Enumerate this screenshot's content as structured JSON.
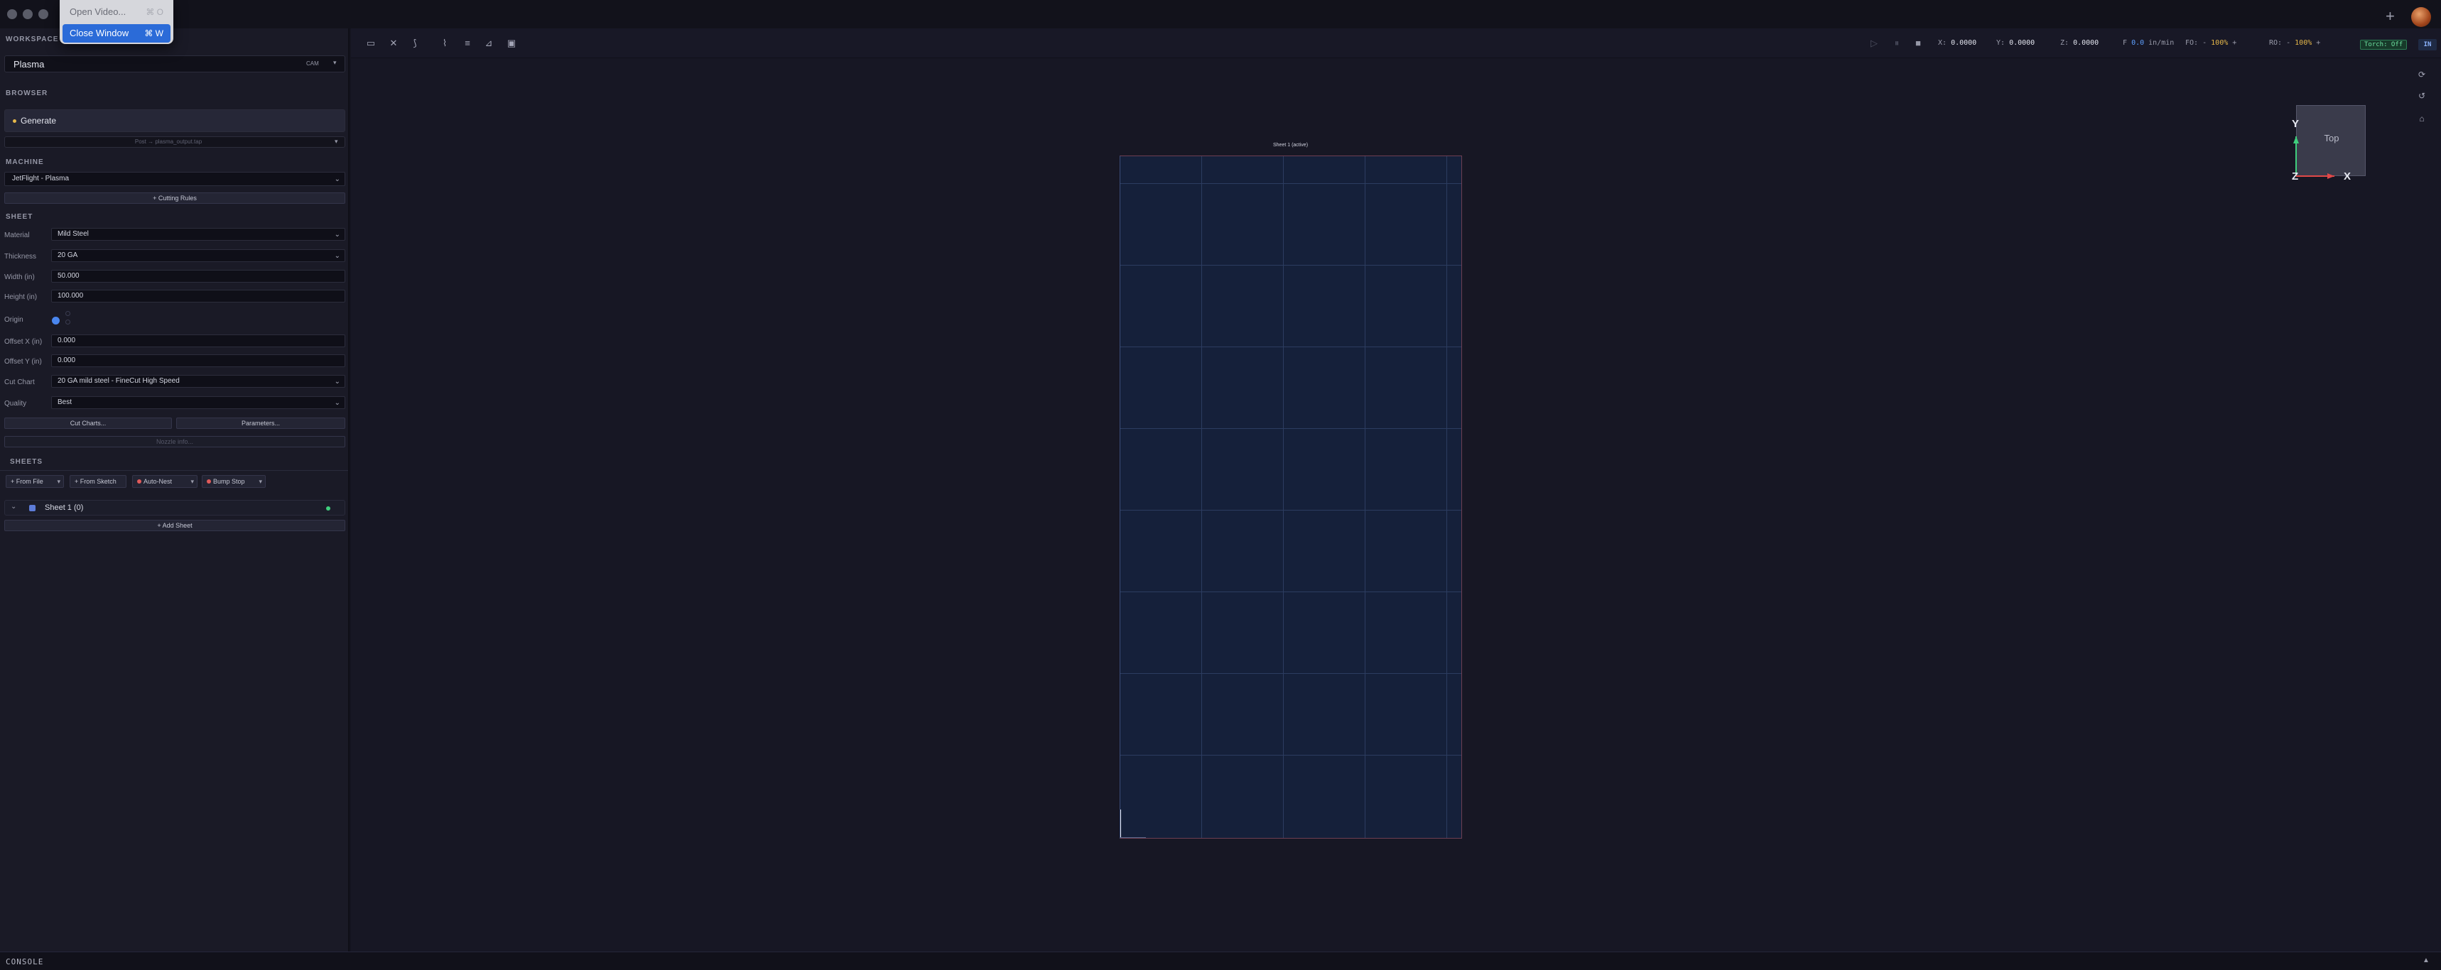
{
  "menu": {
    "open_video": "Open Video...",
    "open_video_shortcut": "⌘ O",
    "close_window": "Close Window",
    "close_window_shortcut": "⌘ W"
  },
  "sidebar": {
    "workspace_label": "WORKSPACE",
    "workspace_value": "Plasma",
    "workspace_tag": "CAM",
    "browser_label": "BROWSER",
    "generate_label": "Generate",
    "post_output": "Post → plasma_output.tap",
    "machine_label": "MACHINE",
    "machine_value": "JetFlight - Plasma",
    "cutting_rules": "+ Cutting Rules",
    "sheet_label": "SHEET",
    "fields": {
      "material": {
        "label": "Material",
        "value": "Mild Steel"
      },
      "thickness": {
        "label": "Thickness",
        "value": "20 GA"
      },
      "width": {
        "label": "Width (in)",
        "value": "50.000"
      },
      "height": {
        "label": "Height (in)",
        "value": "100.000"
      },
      "origin": {
        "label": "Origin"
      },
      "offset_x": {
        "label": "Offset X (in)",
        "value": "0.000"
      },
      "offset_y": {
        "label": "Offset Y (in)",
        "value": "0.000"
      },
      "cut_chart": {
        "label": "Cut Chart",
        "value": "20 GA mild steel - FineCut High Speed"
      },
      "quality": {
        "label": "Quality",
        "value": "Best"
      }
    },
    "cut_charts_button": "Cut Charts...",
    "parameters_button": "Parameters...",
    "nozzle_info": "Nozzle info...",
    "sheets_label": "SHEETS",
    "chips": {
      "from_file": "+ From File",
      "from_sketch": "+ From Sketch",
      "auto_nest": "Auto-Nest",
      "bump_stop": "Bump Stop"
    },
    "sheet_item": "Sheet 1 (0)",
    "add_sheet": "+ Add Sheet"
  },
  "toolbar": {
    "x_label": "X:",
    "x_value": "0.0000",
    "y_label": "Y:",
    "y_value": "0.0000",
    "z_label": "Z:",
    "z_value": "0.0000",
    "f_label": "F",
    "f_value": "0.0",
    "f_unit": "in/min",
    "fo_label": "FO:",
    "fo_value": "100%",
    "ro_label": "RO:",
    "ro_value": "100%",
    "torch_status": "Torch: Off",
    "unit_badge": "IN"
  },
  "viewport": {
    "sheet_caption": "Sheet 1 (active)",
    "cube_label": "Top",
    "axis_y": "Y",
    "axis_x": "X",
    "axis_z": "Z"
  },
  "console": {
    "label": "CONSOLE"
  }
}
